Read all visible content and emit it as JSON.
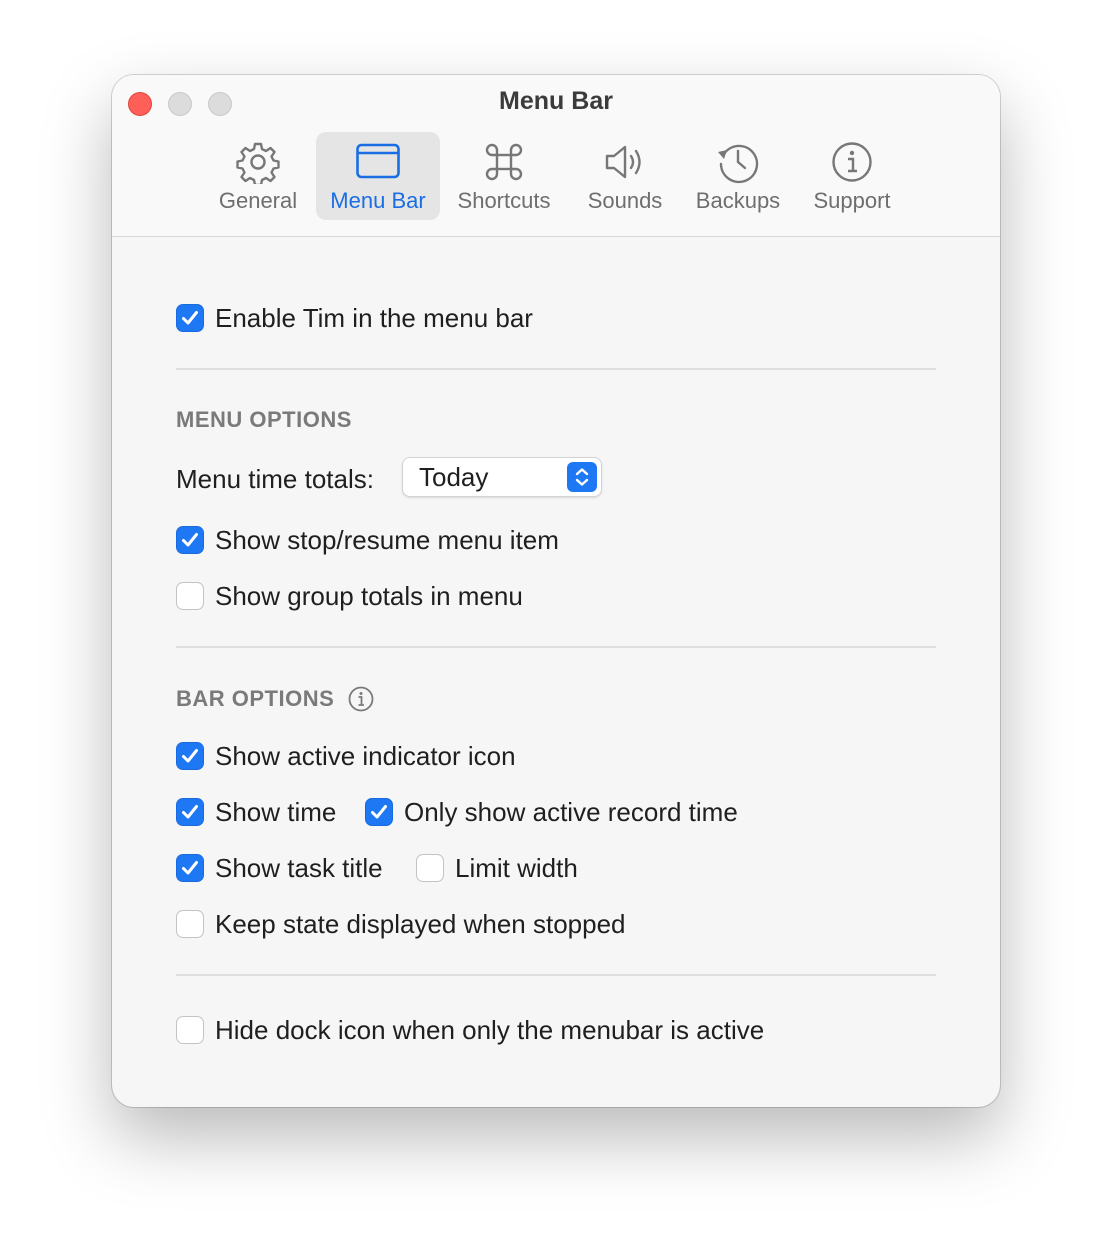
{
  "window": {
    "title": "Menu Bar"
  },
  "toolbar": {
    "items": [
      {
        "label": "General",
        "icon": "gear-icon"
      },
      {
        "label": "Menu Bar",
        "icon": "menubar-window-icon",
        "selected": true
      },
      {
        "label": "Shortcuts",
        "icon": "command-icon"
      },
      {
        "label": "Sounds",
        "icon": "speaker-icon"
      },
      {
        "label": "Backups",
        "icon": "history-clock-icon"
      },
      {
        "label": "Support",
        "icon": "info-circle-icon"
      }
    ]
  },
  "general": {
    "enable_menu_bar": {
      "label": "Enable Tim in the menu bar",
      "checked": true
    }
  },
  "menu_options": {
    "header": "MENU OPTIONS",
    "time_totals_label": "Menu time totals:",
    "time_totals_value": "Today",
    "show_stop_resume": {
      "label": "Show stop/resume menu item",
      "checked": true
    },
    "show_group_totals": {
      "label": "Show group totals in menu",
      "checked": false
    }
  },
  "bar_options": {
    "header": "BAR OPTIONS",
    "show_active_indicator": {
      "label": "Show active indicator icon",
      "checked": true
    },
    "show_time": {
      "label": "Show time",
      "checked": true
    },
    "only_active_record_time": {
      "label": "Only show active record time",
      "checked": true
    },
    "show_task_title": {
      "label": "Show task title",
      "checked": true
    },
    "limit_width": {
      "label": "Limit width",
      "checked": false
    },
    "keep_state": {
      "label": "Keep state displayed when stopped",
      "checked": false
    }
  },
  "dock": {
    "hide_dock_icon": {
      "label": "Hide dock icon when only the menubar is active",
      "checked": false
    }
  },
  "colors": {
    "accent": "#1e78f3",
    "close_light": "#fe5f57",
    "selected_tab_label": "#1a6ee4"
  }
}
